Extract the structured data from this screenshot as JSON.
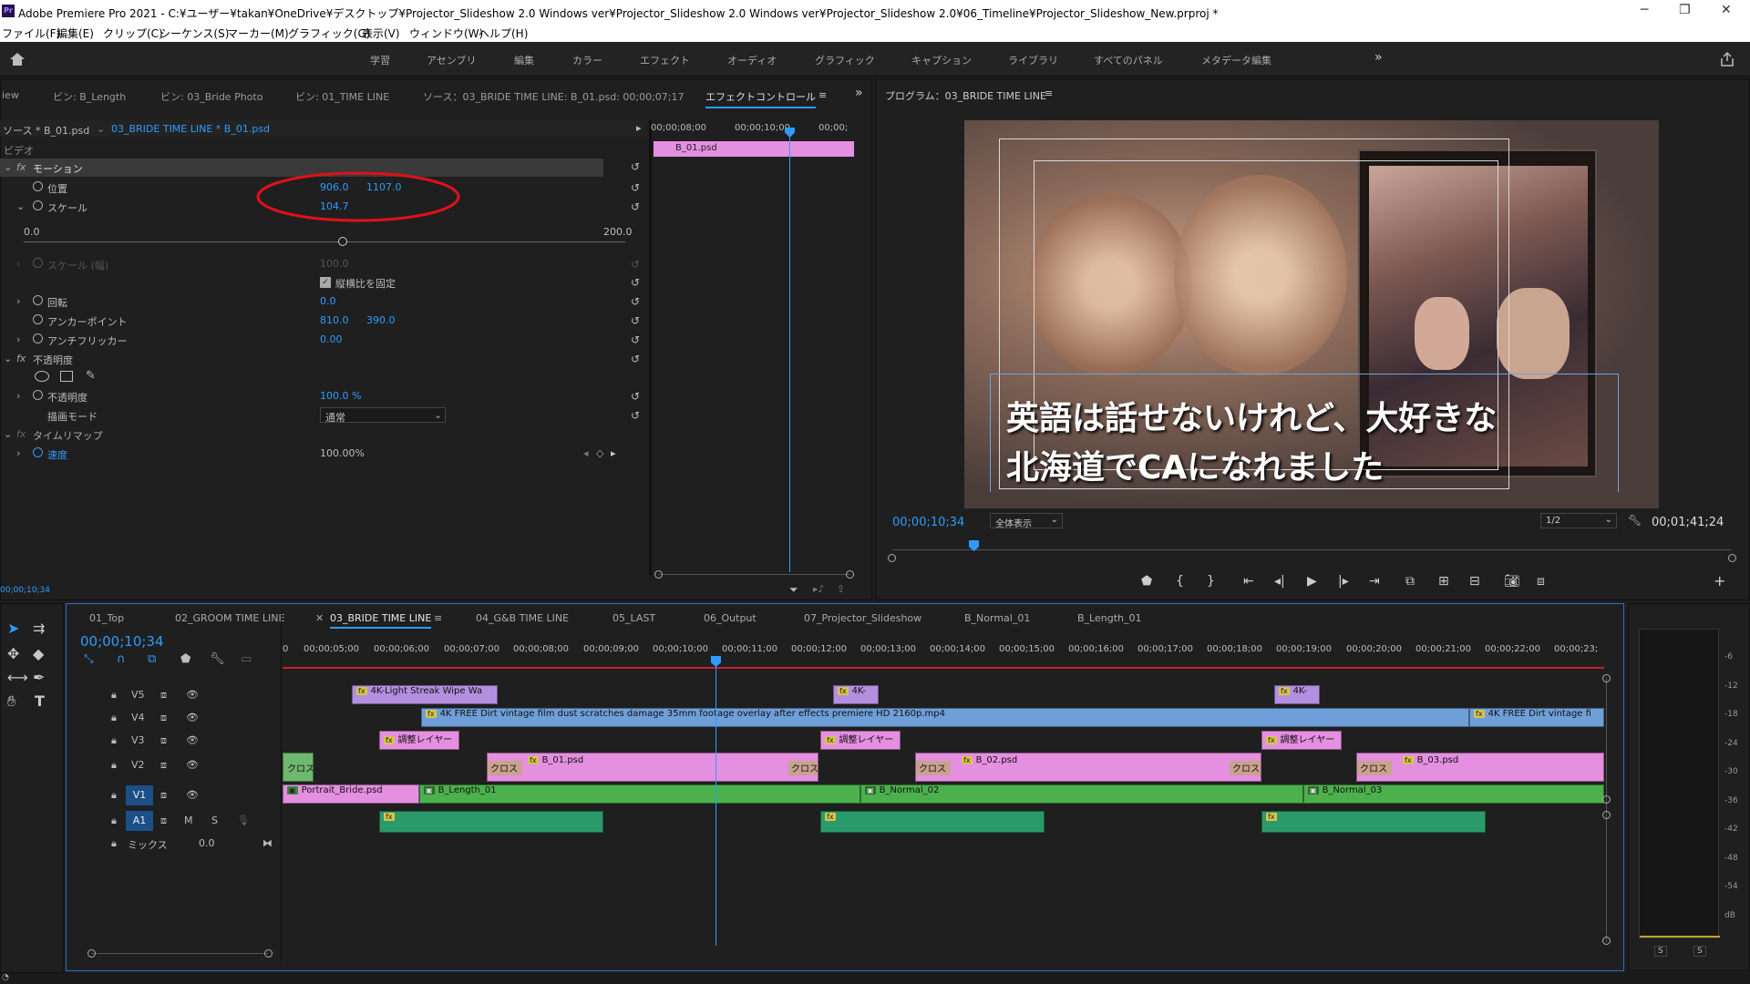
{
  "window": {
    "title": "Adobe Premiere Pro 2021 - C:¥ユーザー¥takan¥OneDrive¥デスクトップ¥Projector_Slideshow 2.0 Windows ver¥Projector_Slideshow 2.0 Windows ver¥Projector_Slideshow 2.0¥06_Timeline¥Projector_Slideshow_New.prproj *",
    "app_icon": "Pr"
  },
  "menu": [
    "ファイル(F)",
    "編集(E)",
    "クリップ(C)",
    "シーケンス(S)",
    "マーカー(M)",
    "グラフィック(G)",
    "表示(V)",
    "ウィンドウ(W)",
    "ヘルプ(H)"
  ],
  "workspaces": [
    "学習",
    "アセンブリ",
    "編集",
    "カラー",
    "エフェクト",
    "オーディオ",
    "グラフィック",
    "キャプション",
    "ライブラリ",
    "すべてのパネル",
    "メタデータ編集"
  ],
  "source_tabs": [
    "iew",
    "ビン: B_Length",
    "ビン: 03_Bride Photo",
    "ビン: 01_TIME LINE",
    "ソース：03_BRIDE TIME LINE: B_01.psd: 00;00;07;17",
    "エフェクトコントロール"
  ],
  "effect_controls": {
    "source_label": "ソース * B_01.psd",
    "sequence_label": "03_BRIDE TIME LINE * B_01.psd",
    "section_video": "ビデオ",
    "motion": "モーション",
    "position_label": "位置",
    "position_x": "906.0",
    "position_y": "1107.0",
    "scale_label": "スケール",
    "scale_value": "104.7",
    "slider_min": "0.0",
    "slider_max": "200.0",
    "scale_width_label": "スケール (幅)",
    "scale_width_value": "100.0",
    "uniform_scale": "縦横比を固定",
    "rotation_label": "回転",
    "rotation_value": "0.0",
    "anchor_label": "アンカーポイント",
    "anchor_x": "810.0",
    "anchor_y": "390.0",
    "antiflicker_label": "アンチフリッカー",
    "antiflicker_value": "0.00",
    "opacity_section": "不透明度",
    "opacity_label": "不透明度",
    "opacity_value": "100.0 %",
    "blend_label": "描画モード",
    "blend_value": "通常",
    "timeremap_section": "タイムリマップ",
    "speed_label": "速度",
    "speed_value": "100.00%",
    "timecode": "00;00;10;34",
    "mini_ruler": [
      "00;00;08;00",
      "00;00;10;00",
      "00;00;"
    ],
    "mini_clip": "B_01.psd"
  },
  "program": {
    "title": "プログラム：03_BRIDE TIME LINE",
    "current_time": "00;00;10;34",
    "fit": "全体表示",
    "resolution": "1/2",
    "duration": "00;01;41;24",
    "caption_line1": "英語は話せないけれど、大好きな",
    "caption_line2": "北海道でCAになれました"
  },
  "timeline": {
    "tabs": [
      "01_Top",
      "02_GROOM TIME LINE",
      "03_BRIDE TIME LINE",
      "04_G&B TIME LINE",
      "05_LAST",
      "06_Output",
      "07_Projector_Slideshow",
      "B_Normal_01",
      "B_Length_01"
    ],
    "current_time": "00;00;10;34",
    "ruler": [
      "0",
      "00;00;05;00",
      "00;00;06;00",
      "00;00;07;00",
      "00;00;08;00",
      "00;00;09;00",
      "00;00;10;00",
      "00;00;11;00",
      "00;00;12;00",
      "00;00;13;00",
      "00;00;14;00",
      "00;00;15;00",
      "00;00;16;00",
      "00;00;17;00",
      "00;00;18;00",
      "00;00;19;00",
      "00;00;20;00",
      "00;00;21;00",
      "00;00;22;00",
      "00;00;23;"
    ],
    "tracks": [
      "V5",
      "V4",
      "V3",
      "V2",
      "V1",
      "A1"
    ],
    "mix_label": "ミックス",
    "mix_value": "0.0",
    "clips": {
      "v5": [
        "4K-Light Streak Wipe Wa",
        "4K-",
        "4K-"
      ],
      "v4": [
        "4K FREE Dirt vintage film dust scratches damage 35mm footage overlay after effects premiere HD 2160p.mp4",
        "4K FREE Dirt vintage fi"
      ],
      "v3": [
        "調整レイヤー",
        "調整レイヤー",
        "調整レイヤー"
      ],
      "v2": [
        "クロス",
        "クロス",
        "B_01.psd",
        "クロス",
        "クロス",
        "B_02.psd",
        "クロス",
        "クロス",
        "B_03.psd"
      ],
      "v1": [
        "Portrait_Bride.psd",
        "B_Length_01",
        "B_Normal_02",
        "B_Normal_03"
      ]
    }
  },
  "meter": {
    "scale": [
      "-6",
      "-12",
      "-18",
      "-24",
      "-30",
      "-36",
      "-42",
      "-48",
      "-54",
      "dB"
    ],
    "solo": [
      "S",
      "S"
    ]
  }
}
